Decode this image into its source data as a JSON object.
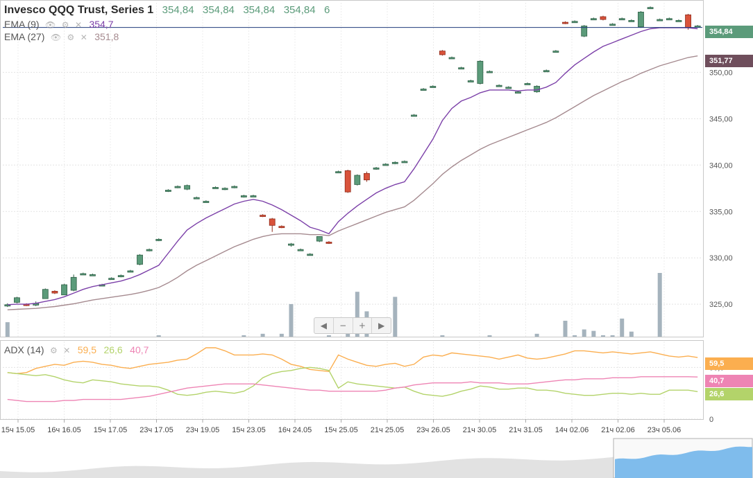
{
  "header": {
    "title": "Invesco QQQ Trust, Series 1",
    "ohlcv": [
      "354,84",
      "354,84",
      "354,84",
      "354,84",
      "6"
    ]
  },
  "indicators": {
    "ema9": {
      "label": "EMA (9)",
      "value": "354,7"
    },
    "ema27": {
      "label": "EMA (27)",
      "value": "351,8"
    },
    "adx": {
      "label": "ADX (14)",
      "adx": "59,5",
      "pdi": "26,6",
      "mdi": "40,7"
    }
  },
  "price_tags": {
    "last": "354,84",
    "ema27": "351,77",
    "adx": "59,5",
    "mdi": "40,7",
    "pdi": "26,6"
  },
  "navigation": {
    "left": "◀",
    "zoom_out": "−",
    "zoom_in": "+",
    "right": "▶"
  },
  "colors": {
    "up": "#5b9b7a",
    "down": "#d9533b",
    "ema9": "#7b3fa8",
    "ema27": "#a58a8f",
    "volume": "#a5b3bd",
    "adx": "#fbae4f",
    "pdi": "#b3d36a",
    "mdi": "#ee84b4",
    "last_tag": "#5b9b7a",
    "ema27_tag": "#6f4e5c"
  },
  "chart_data": [
    {
      "type": "candlestick",
      "title": "Invesco QQQ Trust, Series 1",
      "y_ticks": [
        "325,00",
        "330,00",
        "335,00",
        "340,00",
        "345,00",
        "350,00"
      ],
      "ylim": [
        321.5,
        357.5
      ],
      "x_ticks": [
        "15ч 15.05",
        "16ч 16.05",
        "15ч 17.05",
        "23ч 17.05",
        "23ч 19.05",
        "15ч 23.05",
        "16ч 24.05",
        "15ч 25.05",
        "21ч 25.05",
        "23ч 26.05",
        "21ч 30.05",
        "21ч 31.05",
        "14ч 02.06",
        "21ч 02.06",
        "23ч 05.06"
      ],
      "candles": [
        [
          324.85,
          325.1,
          324.7,
          324.95
        ],
        [
          325.2,
          325.8,
          325.1,
          325.7
        ],
        [
          325.0,
          325.1,
          324.8,
          324.9
        ],
        [
          324.9,
          325.3,
          324.8,
          325.1
        ],
        [
          325.6,
          326.7,
          325.6,
          326.6
        ],
        [
          326.4,
          326.5,
          326.1,
          326.2
        ],
        [
          326.0,
          327.2,
          326.0,
          327.1
        ],
        [
          326.5,
          328.2,
          326.4,
          327.9
        ],
        [
          328.3,
          328.4,
          328.2,
          328.3
        ],
        [
          328.2,
          328.3,
          328.1,
          328.2
        ],
        [
          327.1,
          327.2,
          327.0,
          327.1
        ],
        [
          327.8,
          327.9,
          327.7,
          327.8
        ],
        [
          328.0,
          328.2,
          327.9,
          328.1
        ],
        [
          328.6,
          328.7,
          328.5,
          328.6
        ],
        [
          329.3,
          330.4,
          329.2,
          330.3
        ],
        [
          330.8,
          331.0,
          330.7,
          330.9
        ],
        [
          331.9,
          332.1,
          331.8,
          332.0
        ],
        [
          337.2,
          337.4,
          337.1,
          337.3
        ],
        [
          337.6,
          337.8,
          337.5,
          337.7
        ],
        [
          337.4,
          337.9,
          337.3,
          337.8
        ],
        [
          336.5,
          336.6,
          336.4,
          336.5
        ],
        [
          336.1,
          336.2,
          336.0,
          336.1
        ],
        [
          337.6,
          337.7,
          337.5,
          337.6
        ],
        [
          337.4,
          337.6,
          337.3,
          337.5
        ],
        [
          337.6,
          337.8,
          337.5,
          337.7
        ],
        [
          336.6,
          336.8,
          336.5,
          336.7
        ],
        [
          336.7,
          336.8,
          336.6,
          336.7
        ],
        [
          334.6,
          334.7,
          334.4,
          334.5
        ],
        [
          334.2,
          334.3,
          332.8,
          333.5
        ],
        [
          333.4,
          333.5,
          333.2,
          333.3
        ],
        [
          331.4,
          331.6,
          331.2,
          331.5
        ],
        [
          330.9,
          331.0,
          330.8,
          330.9
        ],
        [
          330.4,
          330.5,
          330.3,
          330.4
        ],
        [
          331.8,
          332.2,
          331.7,
          332.3
        ],
        [
          331.7,
          331.8,
          331.5,
          331.6
        ],
        [
          339.3,
          339.4,
          339.2,
          339.3
        ],
        [
          339.4,
          339.5,
          337.0,
          337.1
        ],
        [
          337.9,
          339.0,
          337.8,
          338.9
        ],
        [
          339.1,
          339.3,
          338.2,
          338.4
        ],
        [
          339.6,
          339.8,
          339.5,
          339.7
        ],
        [
          340.1,
          340.2,
          340.0,
          340.1
        ],
        [
          340.2,
          340.4,
          340.1,
          340.3
        ],
        [
          340.4,
          340.5,
          340.3,
          340.4
        ],
        [
          345.4,
          345.5,
          345.3,
          345.4
        ],
        [
          348.2,
          348.3,
          348.1,
          348.2
        ],
        [
          348.5,
          348.6,
          348.4,
          348.5
        ],
        [
          352.3,
          352.4,
          351.8,
          351.9
        ],
        [
          351.6,
          351.7,
          351.5,
          351.6
        ],
        [
          350.5,
          350.6,
          350.4,
          350.5
        ],
        [
          349.1,
          349.2,
          349.0,
          349.1
        ],
        [
          348.8,
          351.3,
          348.7,
          351.2
        ],
        [
          350.1,
          350.2,
          350.0,
          350.1
        ],
        [
          348.6,
          348.7,
          348.5,
          348.6
        ],
        [
          348.4,
          348.5,
          348.3,
          348.4
        ],
        [
          347.9,
          348.0,
          347.8,
          347.9
        ],
        [
          348.8,
          348.9,
          348.7,
          348.8
        ],
        [
          347.9,
          348.6,
          347.8,
          348.5
        ],
        [
          350.2,
          350.3,
          350.1,
          350.2
        ],
        [
          352.3,
          352.4,
          352.2,
          352.3
        ],
        [
          355.4,
          355.5,
          355.2,
          355.3
        ],
        [
          355.5,
          355.6,
          355.4,
          355.5
        ],
        [
          353.9,
          355.1,
          353.8,
          355.0
        ],
        [
          355.8,
          355.9,
          355.7,
          355.8
        ],
        [
          356.0,
          356.1,
          355.6,
          355.7
        ],
        [
          355.2,
          355.3,
          355.1,
          355.2
        ],
        [
          355.8,
          355.9,
          355.7,
          355.8
        ],
        [
          355.6,
          355.7,
          355.5,
          355.6
        ],
        [
          354.9,
          356.6,
          354.8,
          356.5
        ],
        [
          357.0,
          357.1,
          356.9,
          357.0
        ],
        [
          355.7,
          355.8,
          355.6,
          355.7
        ],
        [
          355.8,
          355.9,
          355.7,
          355.8
        ],
        [
          355.6,
          355.7,
          355.5,
          355.6
        ],
        [
          356.2,
          356.3,
          354.6,
          354.8
        ],
        [
          355.0,
          355.1,
          354.9,
          355.0
        ]
      ],
      "ema9": [
        324.95,
        325.0,
        325.0,
        325.1,
        325.3,
        325.5,
        325.8,
        326.2,
        326.6,
        326.9,
        327.1,
        327.3,
        327.5,
        327.8,
        328.2,
        328.7,
        329.2,
        330.5,
        331.8,
        333.0,
        333.7,
        334.3,
        334.8,
        335.3,
        335.8,
        336.1,
        336.3,
        336.1,
        335.7,
        335.2,
        334.6,
        334.0,
        333.3,
        333.0,
        332.6,
        333.9,
        334.8,
        335.6,
        336.3,
        337.0,
        337.5,
        337.9,
        338.2,
        339.6,
        341.2,
        342.8,
        344.8,
        346.1,
        346.9,
        347.3,
        347.8,
        348.1,
        348.1,
        348.1,
        348.0,
        348.1,
        348.1,
        348.4,
        348.9,
        349.9,
        350.8,
        351.5,
        352.2,
        352.8,
        353.2,
        353.6,
        354.0,
        354.4,
        354.7,
        354.8,
        354.8,
        354.8,
        354.8,
        354.7
      ],
      "ema27": [
        324.4,
        324.45,
        324.5,
        324.55,
        324.65,
        324.75,
        324.9,
        325.05,
        325.25,
        325.45,
        325.6,
        325.75,
        325.9,
        326.05,
        326.25,
        326.5,
        326.8,
        327.3,
        327.9,
        328.6,
        329.2,
        329.7,
        330.2,
        330.7,
        331.2,
        331.6,
        332.0,
        332.3,
        332.5,
        332.6,
        332.6,
        332.6,
        332.5,
        332.5,
        332.4,
        332.9,
        333.3,
        333.7,
        334.1,
        334.5,
        334.9,
        335.2,
        335.5,
        336.2,
        337.1,
        338.0,
        339.0,
        339.8,
        340.5,
        341.1,
        341.7,
        342.2,
        342.6,
        343.0,
        343.4,
        343.8,
        344.2,
        344.6,
        345.1,
        345.7,
        346.3,
        346.9,
        347.5,
        348.0,
        348.5,
        349.0,
        349.4,
        349.9,
        350.3,
        350.7,
        351.0,
        351.3,
        351.6,
        351.77
      ],
      "volume": [
        0.2,
        0.0,
        0.0,
        0.0,
        0.0,
        0.0,
        0.0,
        0.0,
        0.0,
        0.0,
        0.0,
        0.0,
        0.0,
        0.0,
        0.0,
        0.0,
        0.02,
        0.0,
        0.0,
        0.0,
        0.0,
        0.0,
        0.0,
        0.0,
        0.0,
        0.02,
        0.0,
        0.04,
        0.0,
        0.04,
        0.45,
        0.0,
        0.0,
        0.0,
        0.02,
        0.0,
        0.06,
        0.62,
        0.35,
        0.0,
        0.0,
        0.55,
        0.0,
        0.0,
        0.0,
        0.0,
        0.02,
        0.0,
        0.0,
        0.0,
        0.0,
        0.02,
        0.0,
        0.0,
        0.0,
        0.0,
        0.04,
        0.0,
        0.0,
        0.22,
        0.02,
        0.1,
        0.08,
        0.02,
        0.02,
        0.25,
        0.07,
        0.0,
        0.0,
        0.88,
        0.0,
        0.0,
        0.0,
        0.0
      ]
    },
    {
      "type": "line",
      "title": "ADX (14)",
      "y_ticks": [
        "0",
        "50,0"
      ],
      "ylim": [
        0,
        75
      ],
      "series": [
        {
          "name": "ADX (14)",
          "values": [
            45,
            44,
            45,
            49,
            51,
            53,
            52,
            55,
            56,
            55,
            53,
            52,
            50,
            49,
            51,
            53,
            54,
            55,
            57,
            58,
            63,
            69,
            69,
            66,
            62,
            62,
            62,
            63,
            62,
            58,
            53,
            51,
            48,
            47,
            46,
            62,
            58,
            55,
            52,
            51,
            53,
            54,
            51,
            53,
            60,
            62,
            61,
            64,
            63,
            62,
            61,
            60,
            58,
            60,
            62,
            59,
            58,
            59,
            61,
            63,
            66,
            66,
            65,
            64,
            65,
            64,
            63,
            64,
            65,
            63,
            61,
            60,
            61,
            59.5
          ]
        },
        {
          "name": "+DI",
          "values": [
            45,
            44,
            43,
            42,
            43,
            41,
            38,
            36,
            35,
            38,
            37,
            36,
            34,
            33,
            32,
            32,
            31,
            28,
            24,
            23,
            24,
            26,
            27,
            26,
            25,
            27,
            32,
            40,
            44,
            46,
            47,
            49,
            50,
            49,
            47,
            30,
            36,
            34,
            33,
            32,
            31,
            30,
            31,
            27,
            24,
            23,
            22,
            24,
            27,
            29,
            32,
            31,
            29,
            29,
            30,
            30,
            28,
            28,
            27,
            25,
            24,
            23,
            23,
            24,
            25,
            25,
            24,
            25,
            24,
            24,
            28,
            28,
            28,
            26.6
          ]
        },
        {
          "name": "−DI",
          "values": [
            19,
            18,
            17,
            17,
            17,
            17,
            18,
            18,
            19,
            19,
            19,
            19,
            19,
            20,
            21,
            22,
            24,
            26,
            28,
            30,
            31,
            32,
            33,
            34,
            34,
            34,
            34,
            33,
            32,
            31,
            30,
            29,
            28,
            28,
            27,
            27,
            27,
            27,
            27,
            27,
            28,
            30,
            31,
            33,
            34,
            35,
            35,
            35,
            35,
            36,
            35,
            35,
            35,
            34,
            34,
            34,
            35,
            36,
            37,
            38,
            38,
            39,
            39,
            39,
            40,
            40,
            40,
            41,
            41,
            41,
            41,
            41,
            41,
            40.7
          ]
        }
      ]
    }
  ]
}
